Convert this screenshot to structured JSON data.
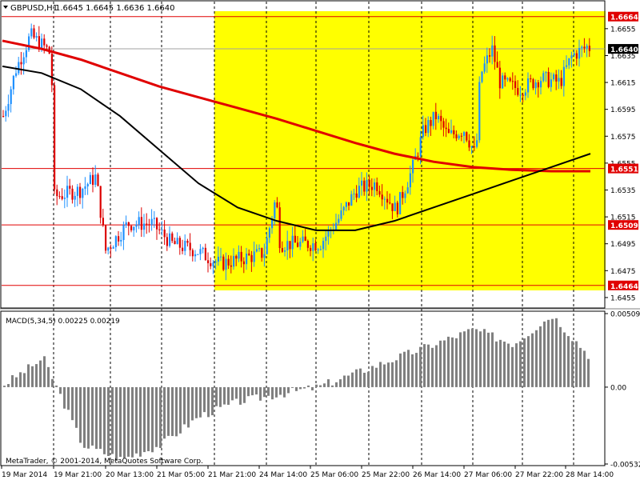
{
  "window": {
    "symbol_label": "GBPUSD,H1",
    "ohlc_label": "1.6645 1.6645 1.6636 1.6640",
    "copyright": "MetaTrader, © 2001-2014, MetaQuotes Software Corp."
  },
  "colors": {
    "bull": "#1e90ff",
    "bear": "#dc0000",
    "ma_fast": "#e00000",
    "ma_slow": "#000000",
    "highlight": "#ffff00",
    "hline": "#e00000",
    "macd_hist": "#808080",
    "macd_signal": "#e00000",
    "price_tag_current": "#000000"
  },
  "price_axis": {
    "ticks": [
      "1.6655",
      "1.6635",
      "1.6615",
      "1.6595",
      "1.6575",
      "1.6555",
      "1.6535",
      "1.6515",
      "1.6495",
      "1.6475",
      "1.6455"
    ],
    "hline_labels": [
      "1.6664",
      "1.6551",
      "1.6509",
      "1.6464"
    ],
    "current_label": "1.6640"
  },
  "macd": {
    "label": "MACD(5,34,5) 0.00225 0.00219",
    "ticks": [
      "0.00509",
      "0.00",
      "-0.00532"
    ]
  },
  "time_axis": {
    "labels": [
      "19 Mar 2014",
      "19 Mar 21:00",
      "20 Mar 13:00",
      "21 Mar 05:00",
      "21 Mar 21:00",
      "24 Mar 14:00",
      "25 Mar 06:00",
      "25 Mar 22:00",
      "26 Mar 14:00",
      "27 Mar 06:00",
      "27 Mar 22:00",
      "28 Mar 14:00"
    ]
  },
  "chart_data": {
    "type": "candlestick",
    "symbol": "GBPUSD",
    "timeframe": "H1",
    "ylim": [
      1.6449,
      1.6668
    ],
    "horizontal_lines": [
      1.6664,
      1.6551,
      1.6509,
      1.6464
    ],
    "current_price": 1.664,
    "highlight_zone": {
      "price_range": [
        1.6464,
        1.6664
      ],
      "from_label": "21 Mar 21:00"
    },
    "ma_fast": [
      1.6646,
      1.664,
      1.6632,
      1.6622,
      1.6612,
      1.6604,
      1.6596,
      1.6588,
      1.6579,
      1.657,
      1.6562,
      1.6556,
      1.6552,
      1.655,
      1.6549,
      1.6549
    ],
    "ma_slow": [
      1.6627,
      1.6622,
      1.661,
      1.659,
      1.6565,
      1.654,
      1.6522,
      1.6512,
      1.6505,
      1.6505,
      1.6512,
      1.6522,
      1.6532,
      1.6542,
      1.6552,
      1.6562
    ],
    "macd": {
      "ylim": [
        -0.00532,
        0.00509
      ],
      "histogram_approx": [
        0.0002,
        0.002,
        -0.004,
        -0.005,
        -0.004,
        -0.002,
        -0.001,
        -0.0005,
        0.0,
        0.001,
        0.002,
        0.003,
        0.004,
        0.003,
        0.005,
        0.002
      ],
      "value": 0.00225,
      "signal": 0.00219
    }
  }
}
